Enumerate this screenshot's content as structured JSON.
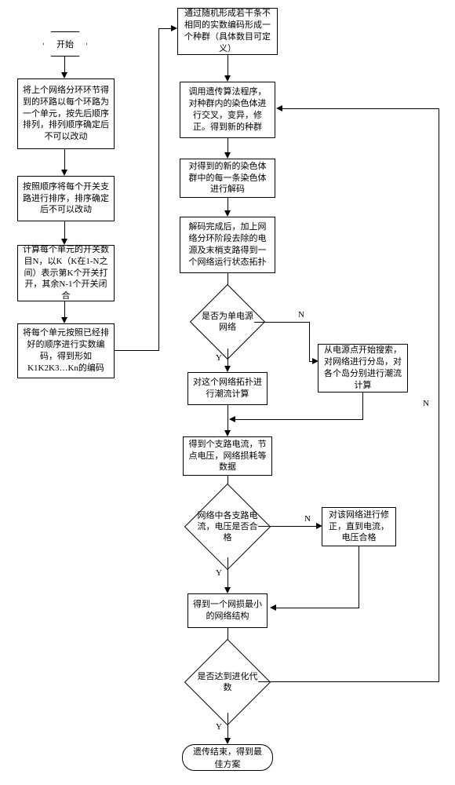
{
  "flowchart": {
    "start": "开始",
    "left1": "将上个网络分环环节得到的环路以每个环路为一个单元，按先后顺序排列，排列顺序确定后不可以改动",
    "left2": "按照顺序将每个开关支路进行排序，排序确定后不可以改动",
    "left3": "计算每个单元的开关数目N，以K（K在1-N之间）表示第K个开关打开，其余N-1个开关闭合",
    "left4": "将每个单元按照已经排好的顺序进行实数编码，得到形如K1K2K3…Kn的编码",
    "top1": "通过随机形成若干条不相同的实数编码形成一个种群（具体数目可定义）",
    "step_ga": "调用遗传算法程序，对种群内的染色体进行交叉，变异，修正。得到新的种群",
    "step_decode": "对得到的新的染色体群中的每一条染色体进行解码",
    "step_topology": "解码完成后，加上网络分环阶段去除的电源及末梢支路得到一个网络运行状态拓扑",
    "d1": "是否为单电源网络",
    "flow_single": "对这个网络拓扑进行潮流计算",
    "flow_multi": "从电源点开始搜索，对网络进行分岛，对各个岛分别进行潮流计算",
    "results": "得到个支路电流，节点电压，网络损耗等数据",
    "d2": "网络中各支路电流，电压是否合格",
    "fix": "对该网络进行修正，直到电流，电压合格",
    "min_loss": "得到一个网损最小的网络结构",
    "d3": "是否达到进化代数",
    "end": "遗传结束，得到最佳方案",
    "yes": "Y",
    "no": "N"
  }
}
